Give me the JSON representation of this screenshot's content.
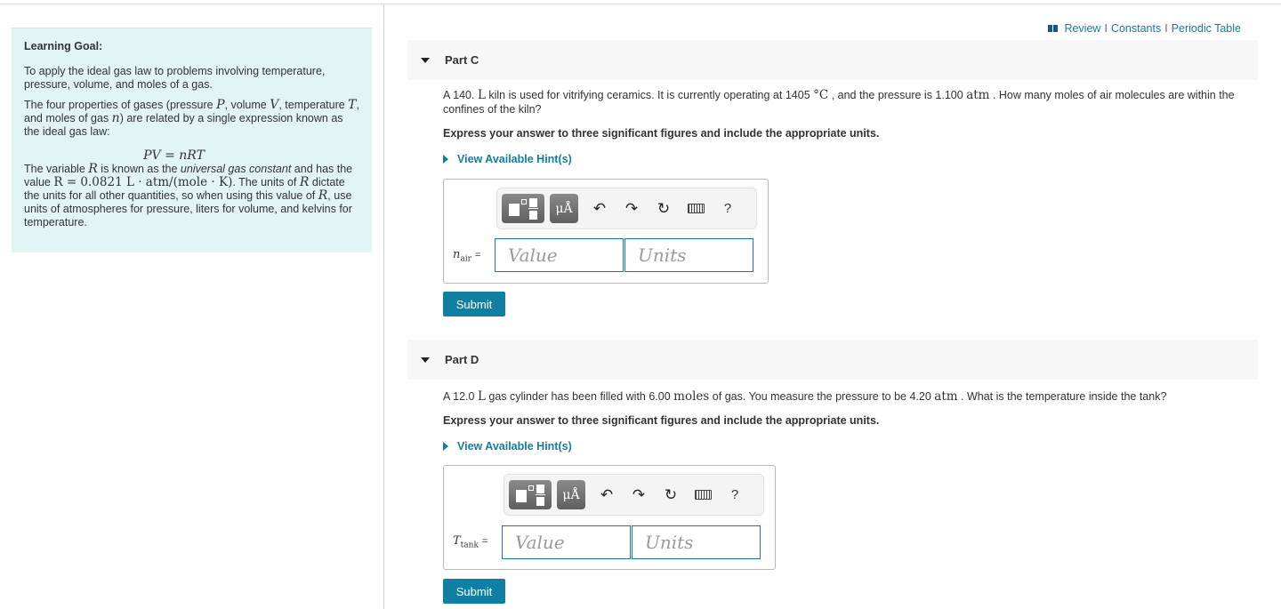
{
  "top_links": {
    "icon": "book-icon",
    "review": "Review",
    "constants": "Constants",
    "periodic_table": "Periodic Table",
    "separator": "I"
  },
  "learning_goal": {
    "heading": "Learning Goal:",
    "p1": "To apply the ideal gas law to problems involving temperature, pressure, volume, and moles of a gas.",
    "p2_a": "The four properties of gases (pressure ",
    "p2_P": "P",
    "p2_b": ", volume ",
    "p2_V": "V",
    "p2_c": ", temperature ",
    "p2_T": "T",
    "p2_d": ", and moles of gas ",
    "p2_n": "n",
    "p2_e": ") are related by a single expression known as the ideal gas law:",
    "equation": "PV = nRT",
    "p3_a": "The variable ",
    "p3_R": "R",
    "p3_b": " is known as the ",
    "p3_em": "universal gas constant",
    "p3_c": " and has the value ",
    "p3_value": "R = 0.0821 L · atm/(mole · K)",
    "p3_d": ". The units of ",
    "p3_R2": "R",
    "p3_e": " dictate the units for all other quantities, so when using this value of ",
    "p3_R3": "R",
    "p3_f": ", use units of atmospheres for pressure, liters for volume, and kelvins for temperature."
  },
  "parts": [
    {
      "title": "Part C",
      "question_a": "A 140. ",
      "question_unit1": "L",
      "question_b": " kiln is used for vitrifying ceramics. It is currently operating at 1405 ",
      "question_unit2": "°C",
      "question_c": " , and the pressure is 1.100 ",
      "question_unit3": "atm",
      "question_d": " . How many moles of air molecules are within the confines of the kiln?",
      "instruction": "Express your answer to three significant figures and include the appropriate units.",
      "hint_label": "View Available Hint(s)",
      "variable": "n",
      "variable_sub": "air",
      "equals": "=",
      "value_placeholder": "Value",
      "units_placeholder": "Units",
      "units_button": "μÅ",
      "help": "?",
      "submit_label": "Submit"
    },
    {
      "title": "Part D",
      "question_a": "A 12.0 ",
      "question_unit1": "L",
      "question_b": " gas cylinder has been filled with 6.00 ",
      "question_unit2": "moles",
      "question_c": " of gas. You measure the pressure to be 4.20 ",
      "question_unit3": "atm",
      "question_d": " . What is the temperature inside the tank?",
      "instruction": "Express your answer to three significant figures and include the appropriate units.",
      "hint_label": "View Available Hint(s)",
      "variable": "T",
      "variable_sub": "tank",
      "equals": "=",
      "value_placeholder": "Value",
      "units_placeholder": "Units",
      "units_button": "μÅ",
      "help": "?",
      "submit_label": "Submit"
    }
  ]
}
